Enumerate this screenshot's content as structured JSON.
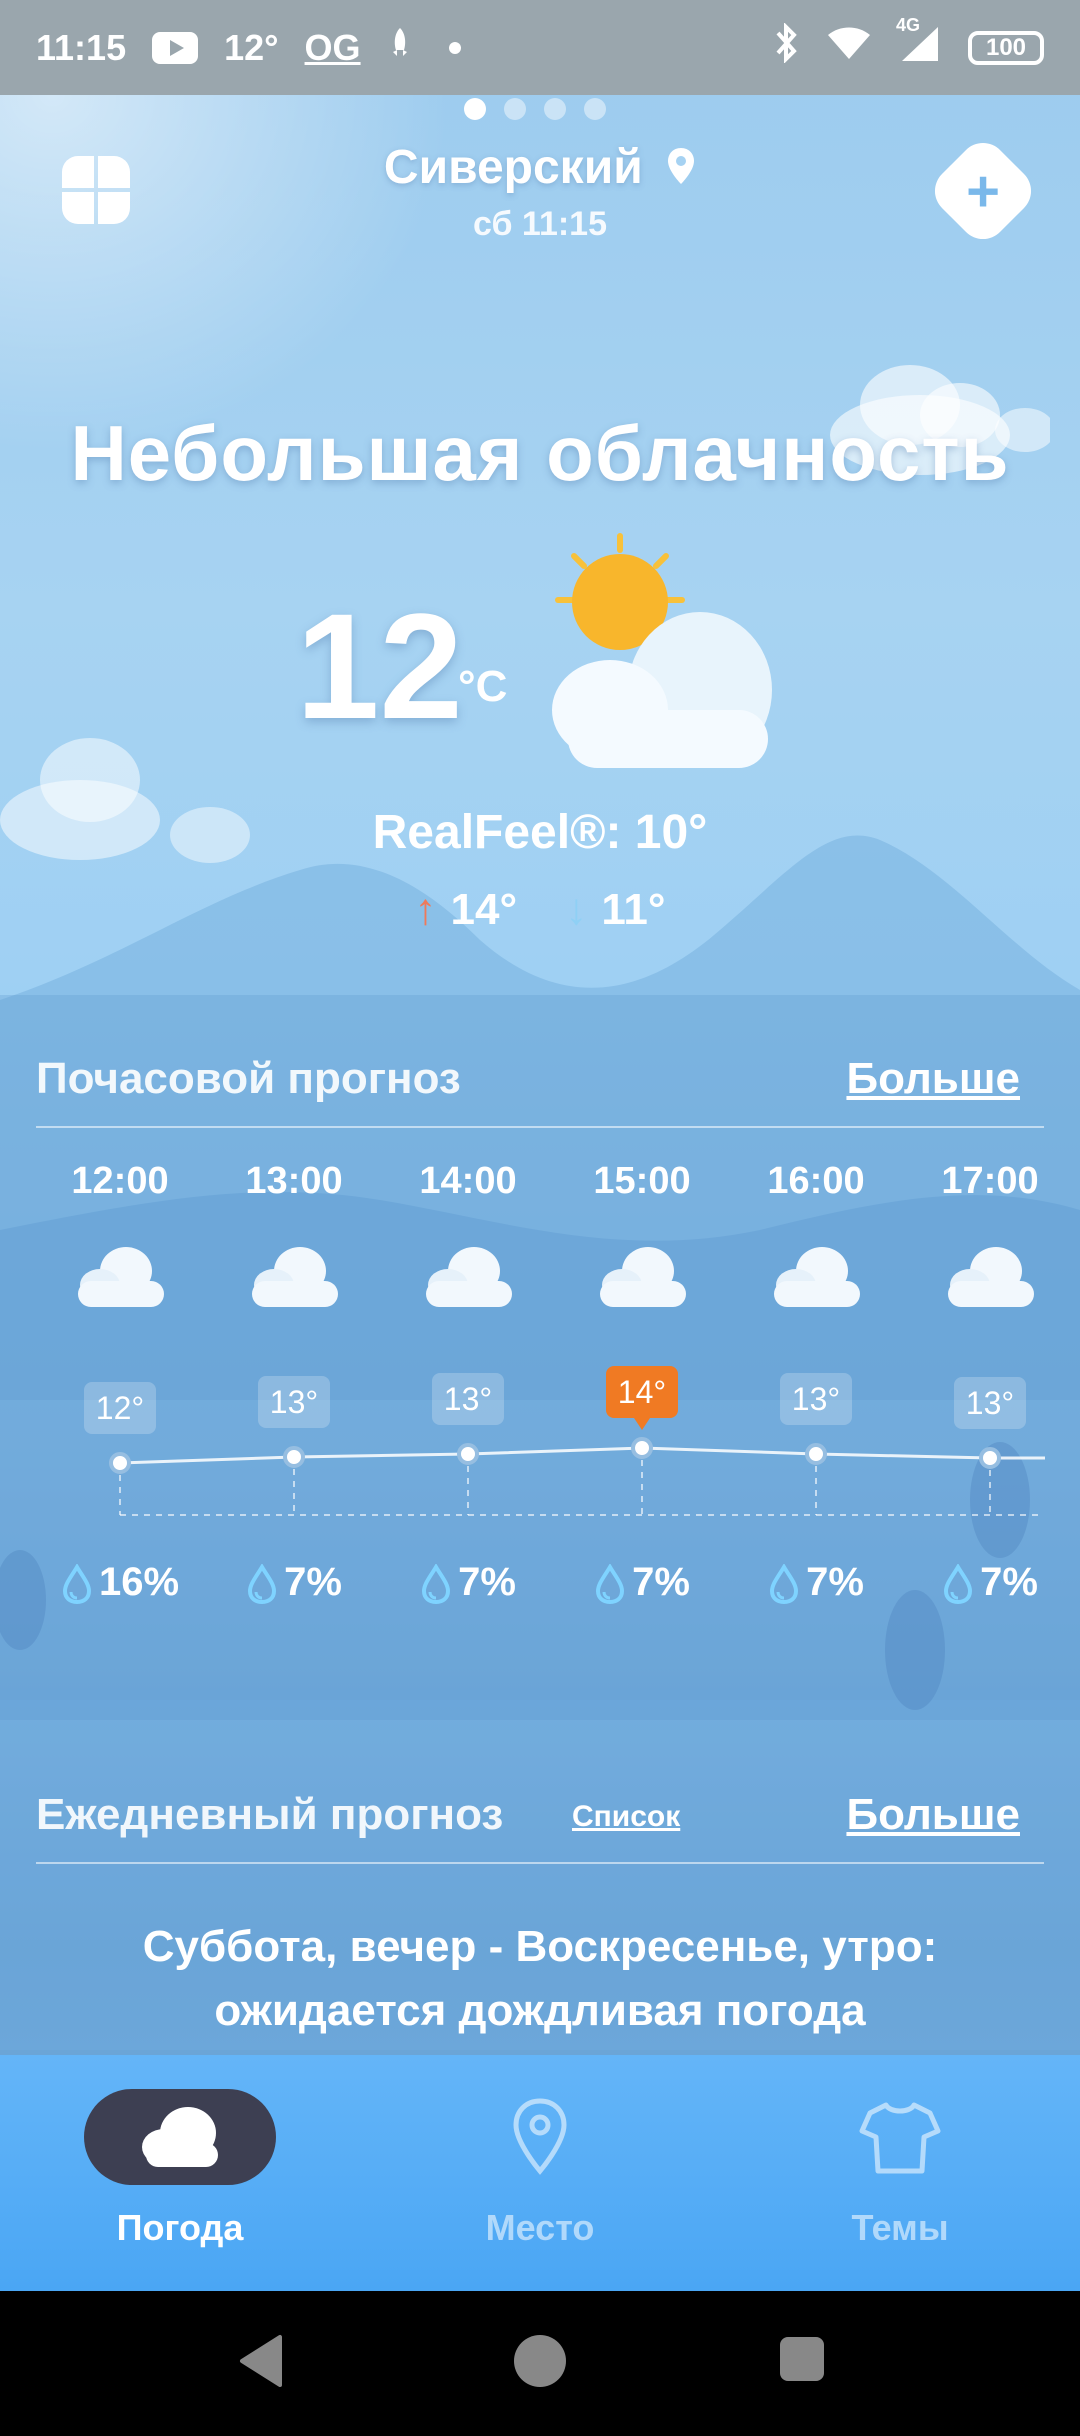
{
  "status_bar": {
    "time": "11:15",
    "temp": "12°",
    "og": "OG",
    "battery": "100",
    "network": "4G"
  },
  "header": {
    "city": "Сиверский",
    "datetime": "сб 11:15"
  },
  "current": {
    "condition": "Небольшая облачность",
    "temp": "12",
    "unit": "°C",
    "realfeel": "RealFeel®: 10°",
    "high": "14°",
    "low": "11°"
  },
  "hourly": {
    "title": "Почасовой прогноз",
    "more": "Больше",
    "hours": [
      {
        "time": "12:00",
        "temp": "12°",
        "precip": "16%"
      },
      {
        "time": "13:00",
        "temp": "13°",
        "precip": "7%"
      },
      {
        "time": "14:00",
        "temp": "13°",
        "precip": "7%"
      },
      {
        "time": "15:00",
        "temp": "14°",
        "precip": "7%"
      },
      {
        "time": "16:00",
        "temp": "13°",
        "precip": "7%"
      },
      {
        "time": "17:00",
        "temp": "13°",
        "precip": "7%"
      }
    ]
  },
  "daily": {
    "title": "Ежедневный прогноз",
    "list": "Список",
    "more": "Больше",
    "summary_line1": "Суббота, вечер - Воскресенье, утро:",
    "summary_line2": "ожидается дождливая погода"
  },
  "bottom_nav": [
    {
      "label": "Погода",
      "icon": "cloud-icon",
      "active": true
    },
    {
      "label": "Место",
      "icon": "location-pin-icon",
      "active": false
    },
    {
      "label": "Темы",
      "icon": "tshirt-icon",
      "active": false
    }
  ],
  "colors": {
    "accent_hot": "#f07a23",
    "up_arrow": "#ef7a5a",
    "down_arrow": "#8fd0f5",
    "nav_bg": "#4aa6f4",
    "nav_pill": "#3d3f52"
  }
}
